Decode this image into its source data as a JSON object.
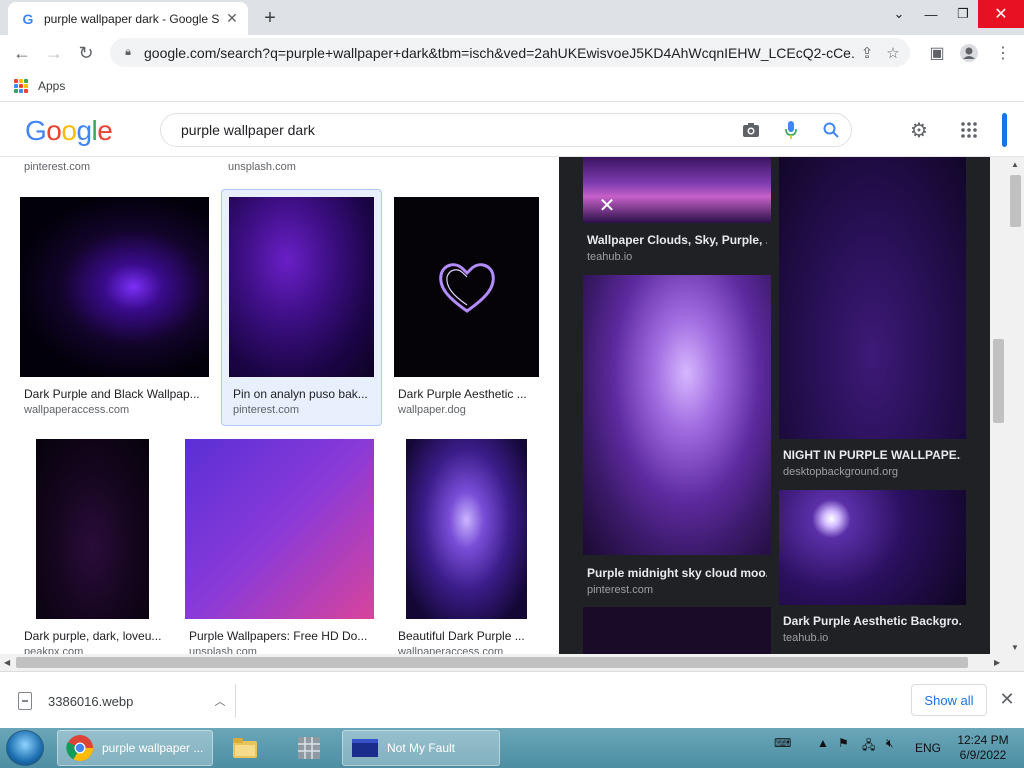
{
  "browser": {
    "tab_title": "purple wallpaper dark - Google S",
    "tab_favicon": "G",
    "url": "google.com/search?q=purple+wallpaper+dark&tbm=isch&ved=2ahUKEwisvoeJ5KD4AhWcqnIEHW_LCEcQ2-cCe...",
    "bookmarks_label": "Apps"
  },
  "google": {
    "logo_letters": [
      "G",
      "o",
      "o",
      "g",
      "l",
      "e"
    ],
    "logo_colors": [
      "#4285f4",
      "#ea4335",
      "#fbbc05",
      "#4285f4",
      "#34a853",
      "#ea4335"
    ],
    "query": "purple wallpaper dark"
  },
  "results": {
    "top_sources": [
      "pinterest.com",
      "unsplash.com"
    ],
    "row1": [
      {
        "caption": "Dark Purple and Black Wallpap...",
        "source": "wallpaperaccess.com"
      },
      {
        "caption": "Pin on analyn puso bak...",
        "source": "pinterest.com"
      },
      {
        "caption": "Dark Purple Aesthetic ...",
        "source": "wallpaper.dog"
      }
    ],
    "row2": [
      {
        "caption": "Dark purple, dark, loveu...",
        "source": "peakpx.com"
      },
      {
        "caption": "Purple Wallpapers: Free HD Do...",
        "source": "unsplash.com"
      },
      {
        "caption": "Beautiful Dark Purple ...",
        "source": "wallpaperaccess.com"
      }
    ]
  },
  "panel": {
    "items": [
      {
        "caption": "Wallpaper Clouds, Sky, Purple, ...",
        "source": "teahub.io"
      },
      {
        "caption": "Purple midnight sky cloud moo...",
        "source": "pinterest.com"
      },
      {
        "caption": "NIGHT IN PURPLE WALLPAPE...",
        "source": "desktopbackground.org"
      },
      {
        "caption": "Dark Purple Aesthetic Backgro...",
        "source": "teahub.io"
      }
    ]
  },
  "downloads": {
    "file_name": "3386016.webp",
    "show_all_label": "Show all"
  },
  "taskbar": {
    "chrome_label": "purple wallpaper ...",
    "window_label": "Not My Fault",
    "language": "ENG",
    "time": "12:24 PM",
    "date": "6/9/2022"
  }
}
